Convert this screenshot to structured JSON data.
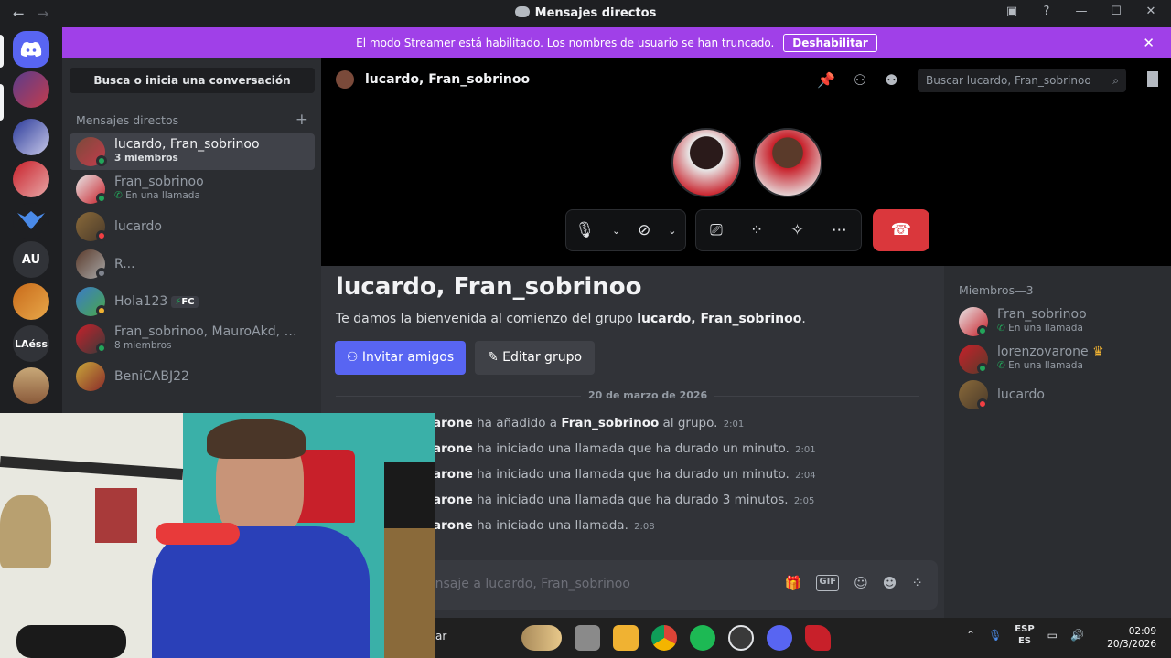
{
  "window": {
    "title": "Mensajes directos"
  },
  "banner": {
    "text": "El modo Streamer está habilitado. Los nombres de usuario se han truncado.",
    "button": "Deshabilitar"
  },
  "servers": {
    "au_label": "AU",
    "laess_label": "LAéss"
  },
  "dm_sidebar": {
    "search": "Busca o inicia una conversación",
    "header": "Mensajes directos",
    "items": [
      {
        "name": "lucardo, Fran_sobrinoo",
        "sub": "3 miembros"
      },
      {
        "name": "Fran_sobrinoo",
        "sub": "En una llamada"
      },
      {
        "name": "lucardo",
        "sub": ""
      },
      {
        "name": "R...",
        "sub": ""
      },
      {
        "name": "Hola123",
        "sub": "",
        "tag": "FC"
      },
      {
        "name": "Fran_sobrinoo, MauroAkd, mati...",
        "sub": "8 miembros"
      },
      {
        "name": "BeniCABJ22",
        "sub": ""
      }
    ]
  },
  "chat_header": {
    "title": "lucardo, Fran_sobrinoo",
    "search_placeholder": "Buscar lucardo, Fran_sobrinoo"
  },
  "welcome": {
    "title": "lucardo, Fran_sobrinoo",
    "text_prefix": "Te damos la bienvenida al comienzo del grupo ",
    "text_bold": "lucardo, Fran_sobrinoo",
    "text_suffix": ".",
    "invite_button": "Invitar amigos",
    "edit_button": "Editar grupo"
  },
  "date_divider": "20 de marzo de 2026",
  "messages": [
    {
      "user": "arone",
      "text": " ha añadido a ",
      "target": "Fran_sobrinoo",
      "tail": " al grupo.",
      "time": "2:01"
    },
    {
      "user": "arone",
      "text": " ha iniciado una llamada que ha durado un minuto.",
      "target": "",
      "tail": "",
      "time": "2:01"
    },
    {
      "user": "arone",
      "text": " ha iniciado una llamada que ha durado un minuto.",
      "target": "",
      "tail": "",
      "time": "2:04"
    },
    {
      "user": "arone",
      "text": " ha iniciado una llamada que ha durado 3 minutos.",
      "target": "",
      "tail": "",
      "time": "2:05"
    },
    {
      "user": "arone",
      "text": " ha iniciado una llamada.",
      "target": "",
      "tail": "",
      "time": "2:08"
    }
  ],
  "composer": {
    "placeholder": "ensaje a lucardo, Fran_sobrinoo"
  },
  "members": {
    "header": "Miembros—3",
    "list": [
      {
        "name": "Fran_sobrinoo",
        "sub": "En una llamada"
      },
      {
        "name": "lorenzovarone",
        "sub": "En una llamada"
      },
      {
        "name": "lucardo",
        "sub": ""
      }
    ]
  },
  "taskbar": {
    "search_fragment": "ar",
    "lang_top": "ESP",
    "lang_bottom": "ES",
    "time": "02:09",
    "date": "20/3/2026"
  },
  "colors": {
    "accent": "#5865f2",
    "banner": "#a040e8",
    "hangup": "#da373c",
    "online": "#23a55a",
    "dnd": "#f23f43"
  }
}
